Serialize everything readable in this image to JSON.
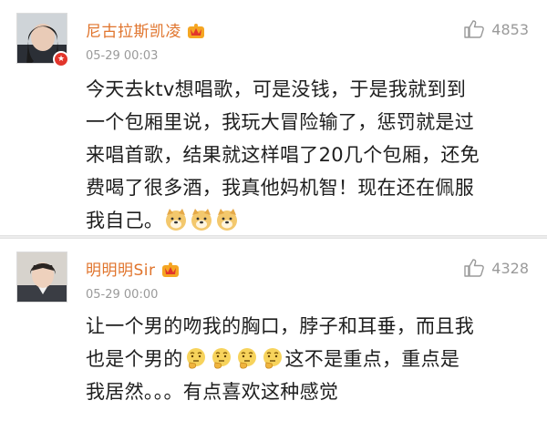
{
  "comments": [
    {
      "username": "尼古拉斯凯凌",
      "time": "05-29 00:03",
      "likes": "4853",
      "has_vip_badge": true,
      "lines": [
        "今天去ktv想唱歌，可是没钱，于是我就到到",
        "一个包厢里说，我玩大冒险输了，惩罚就是过",
        "来唱首歌，结果就这样唱了20几个包厢，还免",
        "费喝了很多酒，我真他妈机智！现在还在佩服",
        "我自己。"
      ],
      "emoji_name": "doge-emoji"
    },
    {
      "username": "明明明Sir",
      "time": "05-29 00:00",
      "likes": "4328",
      "lines": [
        "让一个男的吻我的胸口，脖子和耳垂，而且我",
        "也是个男的",
        "这不是重点，重点是",
        "我居然。。。有点喜欢这种感觉"
      ],
      "emoji_name": "thinking-emoji"
    }
  ],
  "colors": {
    "username": "#e0742c",
    "meta": "#9a9a9a",
    "text": "#1e1e1e"
  }
}
